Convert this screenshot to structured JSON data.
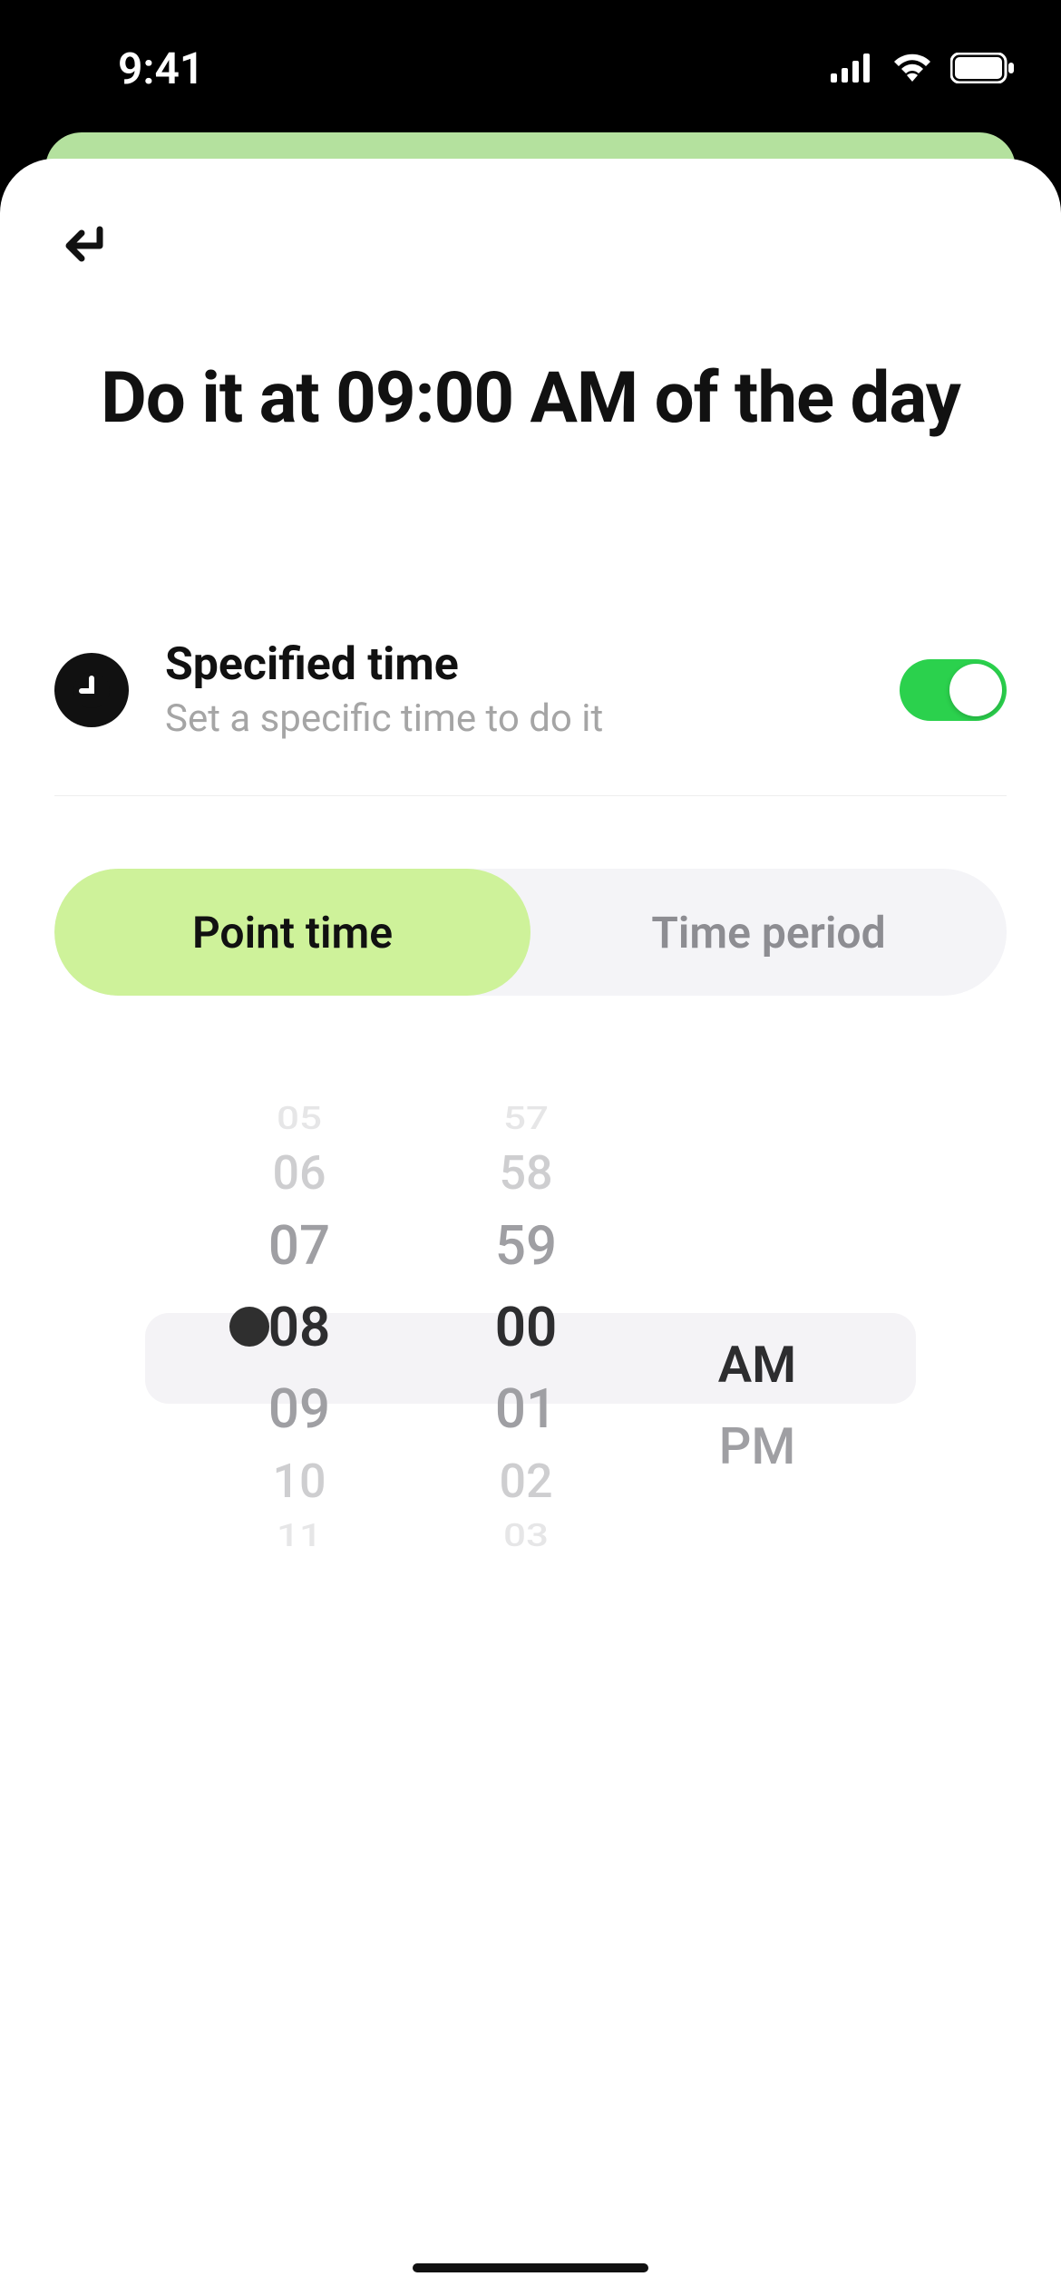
{
  "status": {
    "time": "9:41"
  },
  "header": {
    "title": "Do it at 09:00 AM of the day"
  },
  "specified_time": {
    "label": "Specified time",
    "sub": "Set a specific time to do it",
    "enabled": true
  },
  "segmented": {
    "options": [
      "Point time",
      "Time period"
    ],
    "selected": "Point time"
  },
  "picker": {
    "hours": {
      "faded_top2": "05",
      "faded_top1": "06",
      "top1": "07",
      "selected": "08",
      "bottom1": "09",
      "faded_bottom1": "10",
      "faded_bottom2": "11"
    },
    "minutes": {
      "faded_top2": "57",
      "faded_top1": "58",
      "top1": "59",
      "selected": "00",
      "bottom1": "01",
      "faded_bottom1": "02",
      "faded_bottom2": "03"
    },
    "ampm": {
      "selected": "AM",
      "other": "PM"
    }
  }
}
